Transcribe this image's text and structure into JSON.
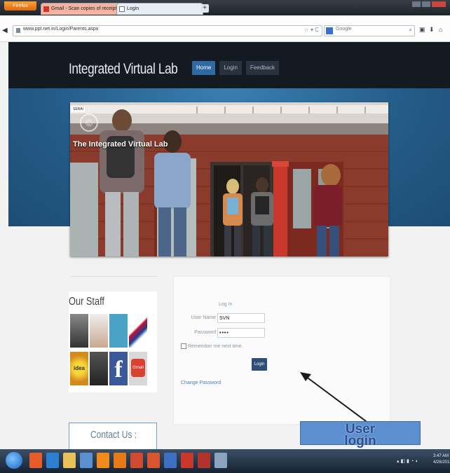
{
  "browser": {
    "firefox_label": "Firefox",
    "tabs": [
      {
        "label": "Gmail - Scan copies of receipt"
      },
      {
        "label": "Login"
      }
    ],
    "new_tab": "+",
    "url": "www.ppt.net.in/Login/Parents.aspx",
    "search_placeholder": "Google"
  },
  "site": {
    "title": "Integrated Virtual Lab",
    "menu": [
      {
        "label": "Home",
        "active": true
      },
      {
        "label": "Login",
        "active": false
      },
      {
        "label": "Feedback",
        "active": false
      }
    ],
    "hero_caption": "The Integrated Virtual Lab",
    "hero_badge": "SERAI"
  },
  "staff": {
    "title": "Our Staff",
    "tiles": [
      "photo",
      "photo",
      "calendar",
      "flag",
      "idea",
      "photo",
      "facebook",
      "gmail"
    ],
    "idea_label": "idea",
    "facebook_label": "f",
    "gmail_label": "Gmail"
  },
  "contact": {
    "label": "Contact Us :"
  },
  "login": {
    "title": "Log In",
    "username_label": "User Name",
    "username_value": "SVN",
    "password_label": "Password",
    "password_value": "••••",
    "remember_label": "Remember me next time.",
    "login_button": "Login",
    "change_password": "Change Password"
  },
  "annotation": {
    "text": "User login"
  },
  "taskbar": {
    "clock_time": "3:47 AM",
    "clock_date": "4/26/2014"
  }
}
